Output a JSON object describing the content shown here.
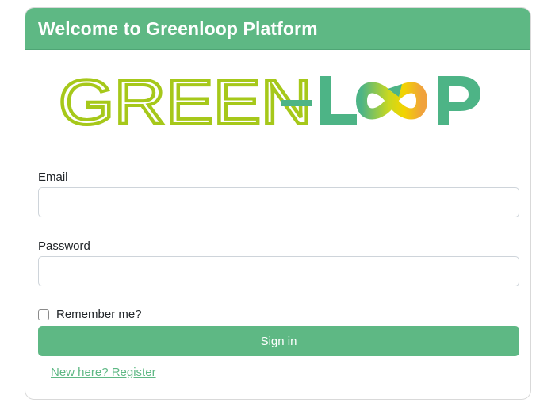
{
  "header": {
    "title": "Welcome to Greenloop Platform"
  },
  "logo": {
    "text_left": "GREEN-",
    "text_right": "L  P",
    "colors": {
      "green_text": "#a6c81a",
      "teal_text": "#4db486",
      "loop_yellow": "#f2d400",
      "loop_orange": "#f0a23c"
    }
  },
  "form": {
    "email_label": "Email",
    "email_value": "",
    "password_label": "Password",
    "password_value": "",
    "remember_label": "Remember me?",
    "remember_checked": false,
    "signin_label": "Sign in",
    "register_link": "New here? Register"
  },
  "colors": {
    "accent": "#5eb884",
    "text": "#212529",
    "border": "#ced4da"
  }
}
